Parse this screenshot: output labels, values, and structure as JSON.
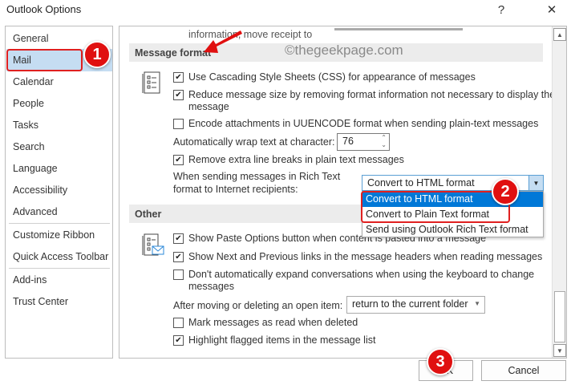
{
  "window": {
    "title": "Outlook Options",
    "help": "?",
    "close": "✕"
  },
  "nav": {
    "items": [
      {
        "label": "General"
      },
      {
        "label": "Mail",
        "selected": true
      },
      {
        "label": "Calendar"
      },
      {
        "label": "People"
      },
      {
        "label": "Tasks"
      },
      {
        "label": "Search"
      },
      {
        "label": "Language"
      },
      {
        "label": "Accessibility"
      },
      {
        "label": "Advanced"
      },
      {
        "label": "Customize Ribbon"
      },
      {
        "label": "Quick Access Toolbar"
      },
      {
        "label": "Add-ins"
      },
      {
        "label": "Trust Center"
      }
    ]
  },
  "top_partial": "information, move receipt to",
  "watermark": "©thegeekpage.com",
  "message_format": {
    "header": "Message format",
    "css": {
      "label": "Use Cascading Style Sheets (CSS) for appearance of messages",
      "checked": true
    },
    "reduce": {
      "label": "Reduce message size by removing format information not necessary to display the",
      "label2": "message",
      "checked": true
    },
    "uuencode": {
      "label": "Encode attachments in UUENCODE format when sending plain-text messages",
      "checked": false
    },
    "wrap": {
      "label": "Automatically wrap text at character:",
      "value": "76"
    },
    "linebreaks": {
      "label": "Remove extra line breaks in plain text messages",
      "checked": true
    },
    "rich": {
      "label1": "When sending messages in Rich Text",
      "label2": "format to Internet recipients:",
      "value": "Convert to HTML format",
      "options": [
        "Convert to HTML format",
        "Convert to Plain Text format",
        "Send using Outlook Rich Text format"
      ],
      "highlighted": "Convert to HTML format"
    }
  },
  "other": {
    "header": "Other",
    "paste": {
      "label": "Show Paste Options button when content is pasted into a message",
      "checked": true
    },
    "nextprev": {
      "label": "Show Next and Previous links in the message headers when reading messages",
      "checked": true
    },
    "expand": {
      "label": "Don't automatically expand conversations when using the keyboard to change",
      "label2": "messages",
      "checked": false
    },
    "after": {
      "label": "After moving or deleting an open item:",
      "value": "return to the current folder"
    },
    "markread": {
      "label": "Mark messages as read when deleted",
      "checked": false
    },
    "flagged": {
      "label": "Highlight flagged items in the message list",
      "checked": true
    }
  },
  "buttons": {
    "ok": "OK",
    "cancel": "Cancel"
  },
  "annotations": {
    "badge1": "1",
    "badge2": "2",
    "badge3": "3",
    "color": "#e01010"
  }
}
